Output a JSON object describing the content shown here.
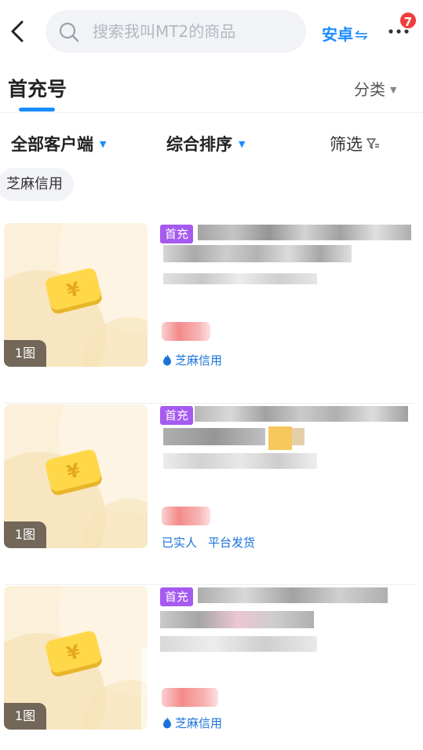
{
  "search": {
    "placeholder": "搜索我叫MT2的商品"
  },
  "header": {
    "platform_label": "安卓",
    "platform_swap": "⇋",
    "more_badge": "7"
  },
  "page": {
    "title": "首充号",
    "category_label": "分类"
  },
  "filters": {
    "client": "全部客户端",
    "sort": "综合排序",
    "filter": "筛选"
  },
  "chip": {
    "label": "芝麻信用"
  },
  "items": [
    {
      "tag": "首充",
      "image_count": "1图",
      "labels": [
        "芝麻信用"
      ]
    },
    {
      "tag": "首充",
      "image_count": "1图",
      "labels": [
        "已实人",
        "平台发货"
      ]
    },
    {
      "tag": "首充",
      "image_count": "1图",
      "labels": [
        "芝麻信用"
      ]
    }
  ],
  "colors": {
    "accent": "#1a8cff",
    "tag": "#a55af0",
    "badge": "#f23d3d",
    "label": "#1a73d9"
  }
}
